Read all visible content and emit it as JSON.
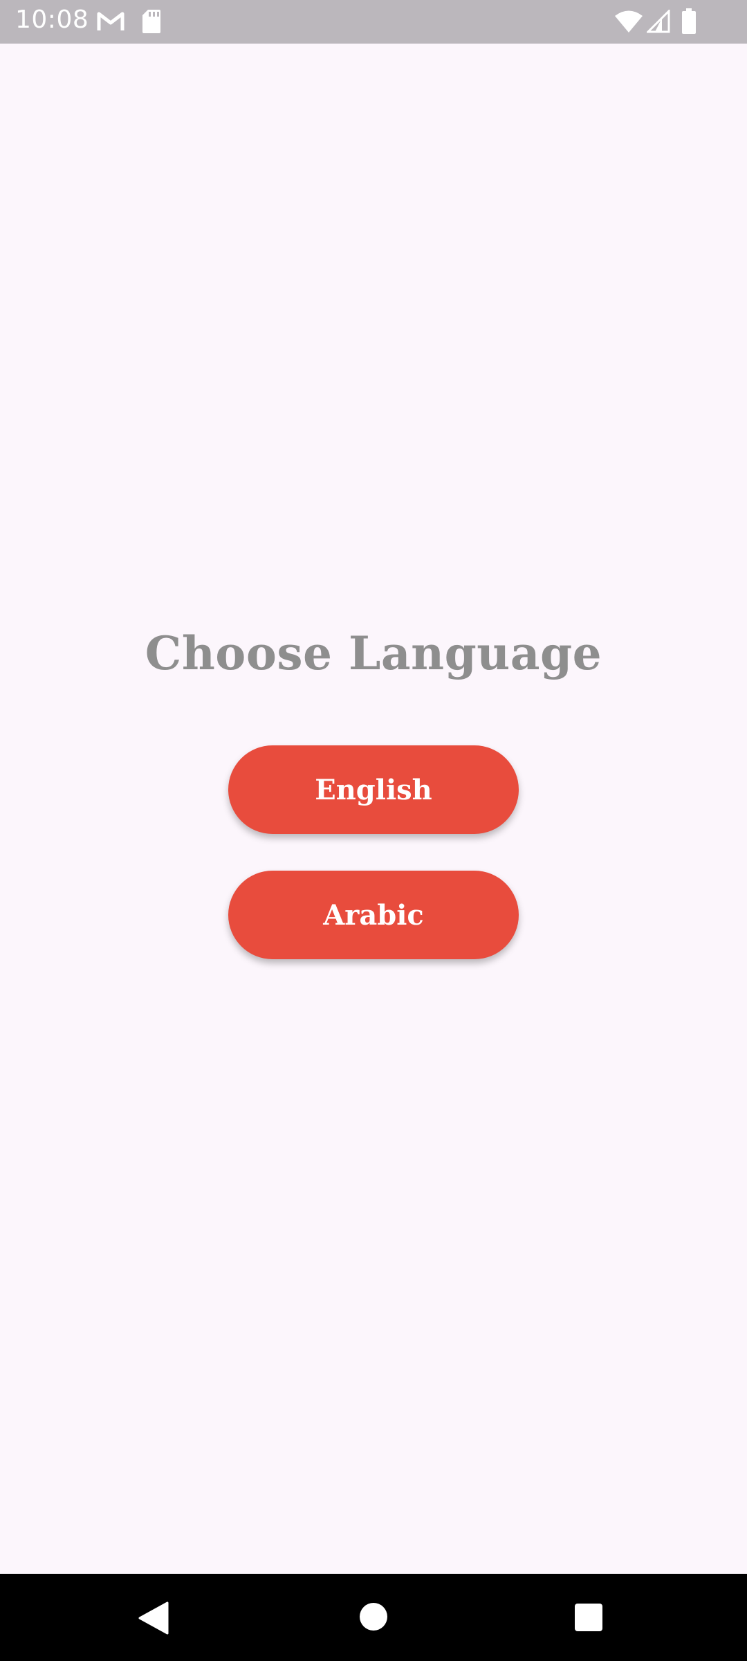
{
  "status_bar": {
    "time": "10:08",
    "icons": [
      "gmail-icon",
      "sd-card-icon",
      "wifi-icon",
      "signal-icon",
      "battery-icon"
    ]
  },
  "main": {
    "title": "Choose Language",
    "buttons": [
      {
        "label": "English"
      },
      {
        "label": "Arabic"
      }
    ]
  },
  "nav_bar": {
    "icons": [
      "back-icon",
      "home-icon",
      "recents-icon"
    ]
  },
  "colors": {
    "accent": "#e84c3d",
    "background": "#fcf6fc",
    "title_text": "#8e8e8e",
    "status_bar": "#bbb7bc"
  }
}
